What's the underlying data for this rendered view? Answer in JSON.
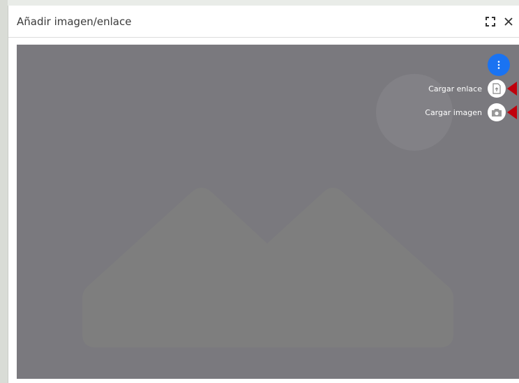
{
  "dialog": {
    "title": "Añadir imagen/enlace",
    "expand_icon": "expand-icon",
    "close_icon": "close-icon"
  },
  "preview": {
    "placeholder_icon": "image-placeholder-icon",
    "background_color": "#7a797e"
  },
  "fab": {
    "main_icon": "more-vertical-icon",
    "main_color": "#1a73f2",
    "actions": [
      {
        "label": "Cargar enlace",
        "icon": "upload-file-icon"
      },
      {
        "label": "Cargar imagen",
        "icon": "camera-icon"
      }
    ],
    "pointer_color": "#c0000c"
  }
}
